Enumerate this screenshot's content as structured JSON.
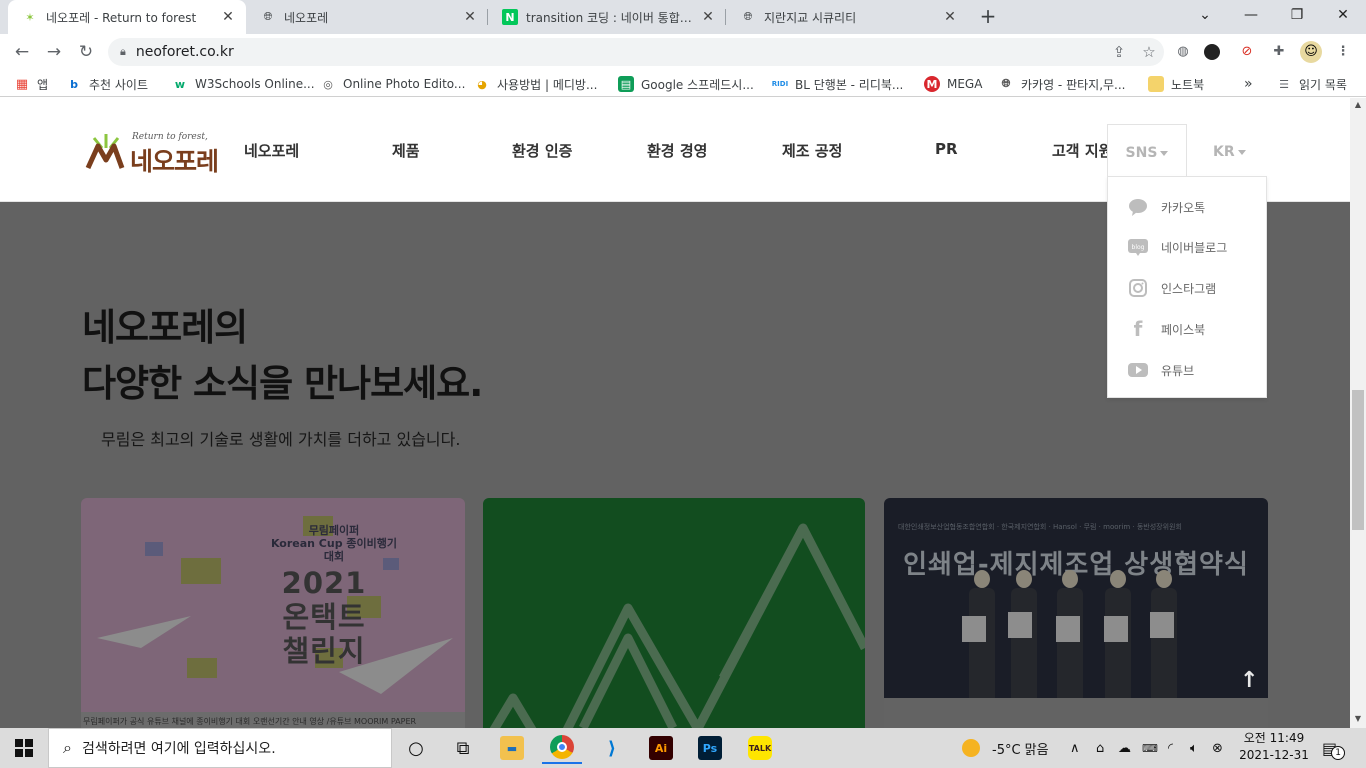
{
  "browser": {
    "tabs": [
      {
        "title": "네오포레 - Return to forest",
        "icon": "neoforet-favicon",
        "active": true
      },
      {
        "title": "네오포레",
        "icon": "globe-icon",
        "active": false
      },
      {
        "title": "transition 코딩 : 네이버 통합검색",
        "icon": "naver-icon",
        "active": false
      },
      {
        "title": "지란지교 시큐리티",
        "icon": "globe-icon",
        "active": false
      }
    ],
    "url": "neoforet.co.kr",
    "bookmarks": [
      {
        "label": "앱",
        "icon": "apps-grid-icon"
      },
      {
        "label": "추천 사이트",
        "icon": "bing-icon"
      },
      {
        "label": "W3Schools Online...",
        "icon": "w3schools-icon"
      },
      {
        "label": "Online Photo Edito...",
        "icon": "aperture-icon"
      },
      {
        "label": "사용방법 | 메디방...",
        "icon": "medibang-icon"
      },
      {
        "label": "Google 스프레드시...",
        "icon": "sheets-icon"
      },
      {
        "label": "BL 단행본 - 리디북...",
        "icon": "ridi-icon"
      },
      {
        "label": "MEGA",
        "icon": "mega-icon"
      },
      {
        "label": "카카영 - 판타지,무...",
        "icon": "globe-icon"
      },
      {
        "label": "노트북",
        "icon": "folder-icon"
      }
    ],
    "bookmarks_more": "»",
    "reading_list": "읽기 목록"
  },
  "site": {
    "logo_slogan": "Return to forest,",
    "logo_name": "네오포레",
    "nav": [
      "네오포레",
      "제품",
      "환경 인증",
      "환경 경영",
      "제조 공정",
      "PR",
      "고객 지원"
    ],
    "sns_label": "SNS",
    "lang_label": "KR",
    "sns_menu": [
      {
        "label": "카카오톡",
        "icon": "kakaotalk-bubble-icon"
      },
      {
        "label": "네이버블로그",
        "icon": "naver-blog-icon"
      },
      {
        "label": "인스타그램",
        "icon": "instagram-icon"
      },
      {
        "label": "페이스북",
        "icon": "facebook-icon"
      },
      {
        "label": "유튜브",
        "icon": "youtube-icon"
      }
    ],
    "title_line1": "네오포레의",
    "title_line2": "다양한 소식을 만나보세요.",
    "subtitle": "무림은 최고의 기술로 생활에 가치를 더하고 있습니다.",
    "cards": [
      {
        "kicker": "무림페이퍼\nKorean Cup 종이비행기대회",
        "headline": "2021\n온택트\n챌린지",
        "caption": "무림페이퍼가 공식 유튜브 채널에 종이비행기 대회 오랜선기간 안내 영상 /유튜브 MOORIM PAPER"
      },
      {
        "kind": "green tree graphic"
      },
      {
        "sponsor": "대한인쇄정보산업협동조합연합회 · 한국제지연합회 · Hansol · 무림 · moorim · 동반성장위원회",
        "headline": "인쇄업-제지제조업 상생협약식"
      }
    ],
    "scroll_top": "↑"
  },
  "taskbar": {
    "search_placeholder": "검색하려면 여기에 입력하십시오.",
    "weather": "-5°C  맑음",
    "time": "오전 11:49",
    "date": "2021-12-31",
    "notifications": "1"
  },
  "colors": {
    "brand_brown": "#7a3e1d",
    "brand_green": "#8cc63f",
    "overlay": "#626262",
    "card_green": "#124d1f"
  }
}
